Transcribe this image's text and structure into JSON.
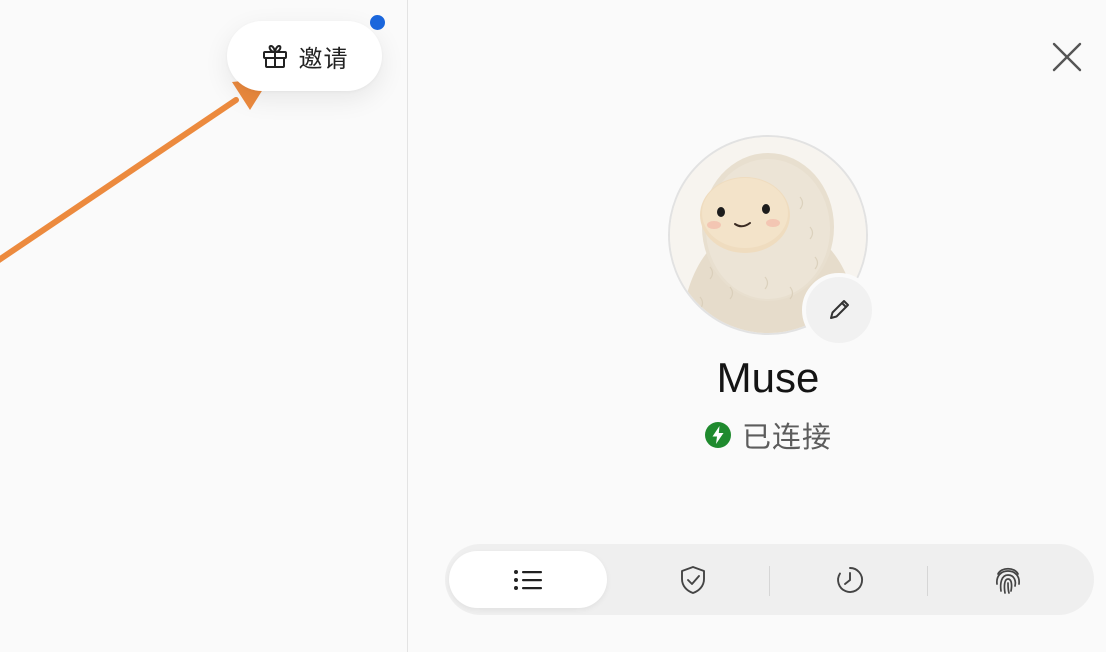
{
  "header": {
    "invite_label": "邀请",
    "invite_icon": "gift-icon",
    "has_notification": true,
    "notification_color": "#1a66dc"
  },
  "profile": {
    "name": "Muse",
    "status_text": "已连接",
    "status_color": "#1f8a2e",
    "status_icon": "lightning-icon",
    "edit_icon": "pencil-icon",
    "close_icon": "close-icon"
  },
  "tabs": [
    {
      "icon": "list-icon",
      "active": true
    },
    {
      "icon": "shield-check-icon",
      "active": false
    },
    {
      "icon": "clock-icon",
      "active": false
    },
    {
      "icon": "fingerprint-icon",
      "active": false
    }
  ],
  "annotation": {
    "arrow_color": "#ec8a3e"
  }
}
